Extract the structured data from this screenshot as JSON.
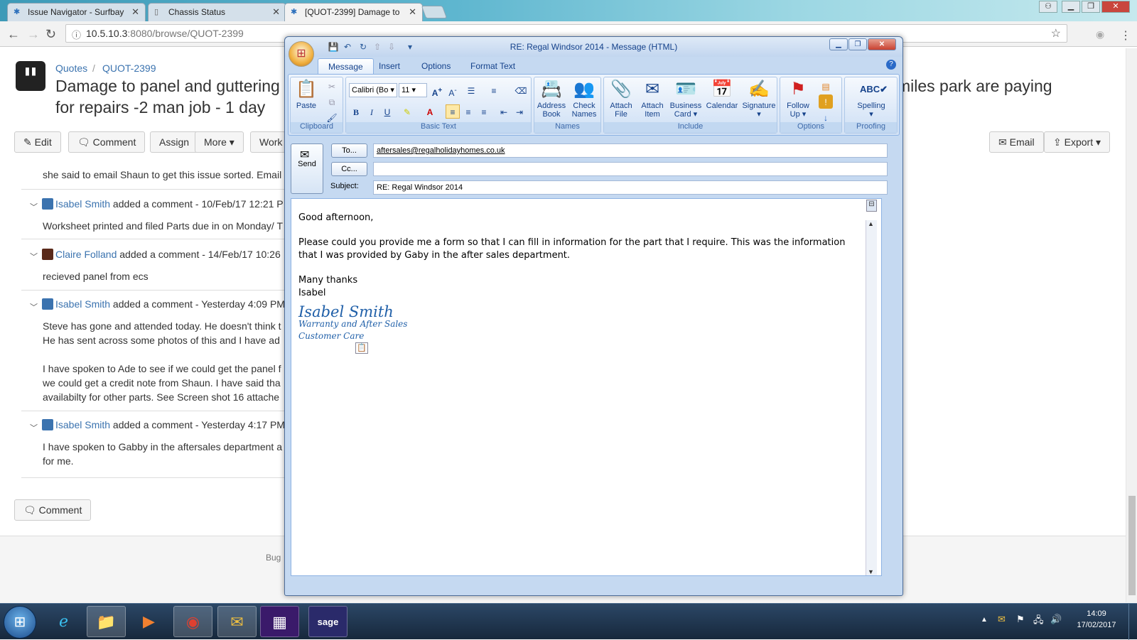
{
  "browser": {
    "tabs": [
      {
        "label": "Issue Navigator - Surfbay",
        "close": "✕"
      },
      {
        "label": "Chassis Status",
        "close": "✕"
      },
      {
        "label": "[QUOT-2399] Damage to",
        "close": "✕"
      }
    ],
    "url_host": "10.5.10.3",
    "url_path": ":8080/browse/QUOT-2399"
  },
  "issue": {
    "breadcrumb_project": "Quotes",
    "breadcrumb_key": "QUOT-2399",
    "title_line1": "Damage to panel and guttering",
    "title_line1_tail": "miles park are paying",
    "title_line2": "for repairs -2 man job - 1 day",
    "toolbar": {
      "edit": "Edit",
      "comment": "Comment",
      "assign": "Assign",
      "more": "More ▾",
      "workflow": "Work",
      "email": "Email",
      "export": "Export ▾"
    }
  },
  "comments": [
    {
      "user": "",
      "meta": "",
      "lines": [
        "she said to email Shaun to get this issue sorted. Email"
      ]
    },
    {
      "user": "Isabel Smith",
      "meta": " added a comment - 10/Feb/17 12:21 P",
      "lines": [
        "Worksheet printed and filed Parts due in on Monday/ T"
      ]
    },
    {
      "user": "Claire Folland",
      "meta": " added a comment - 14/Feb/17 10:26",
      "lines": [
        "recieved panel from ecs"
      ]
    },
    {
      "user": "Isabel Smith",
      "meta": " added a comment - Yesterday 4:09 PM",
      "lines": [
        "Steve has gone and attended today. He doesn't think t",
        "He has sent across some photos of this and I have ad",
        "",
        "I have spoken to Ade to see if we could get the panel f",
        "we could get a credit note from Shaun. I have said tha",
        "availabilty for other parts. See Screen shot 16 attache"
      ]
    },
    {
      "user": "Isabel Smith",
      "meta": " added a comment - Yesterday 4:17 PM",
      "lines": [
        "I have spoken to Gabby in the aftersales department a",
        "for me."
      ]
    }
  ],
  "comment_button": "Comment",
  "footer_text": "Bug",
  "outlook": {
    "window_title": "RE: Regal Windsor 2014 - Message (HTML)",
    "ribbon_tabs": [
      "Message",
      "Insert",
      "Options",
      "Format Text"
    ],
    "groups": {
      "clipboard": "Clipboard",
      "basic_text": "Basic Text",
      "names": "Names",
      "include": "Include",
      "options": "Options",
      "proofing": "Proofing"
    },
    "buttons": {
      "paste": "Paste",
      "address_book_1": "Address",
      "address_book_2": "Book",
      "check_names_1": "Check",
      "check_names_2": "Names",
      "attach_file_1": "Attach",
      "attach_file_2": "File",
      "attach_item_1": "Attach",
      "attach_item_2": "Item",
      "business_card_1": "Business",
      "business_card_2": "Card ▾",
      "calendar": "Calendar",
      "signature": "Signature",
      "follow_up_1": "Follow",
      "follow_up_2": "Up ▾",
      "spelling": "Spelling"
    },
    "font_name": "Calibri (Bo",
    "font_size": "11",
    "send": "Send",
    "to_label": "To...",
    "cc_label": "Cc...",
    "subject_label": "Subject:",
    "to_value": "aftersales@regalholidayhomes.co.uk",
    "cc_value": "",
    "subject_value": "RE: Regal Windsor 2014",
    "body": {
      "greeting": "Good afternoon,",
      "para1": "Please could you provide me a form so that I can fill in information for the part that I require. This was the information that I was provided by Gaby in the after sales department.",
      "closing1": "Many thanks",
      "closing2": "Isabel",
      "sig_name": "Isabel Smith",
      "sig_role": "Warranty and After Sales",
      "sig_dept": "Customer Care"
    }
  },
  "taskbar": {
    "time": "14:09",
    "date": "17/02/2017"
  }
}
